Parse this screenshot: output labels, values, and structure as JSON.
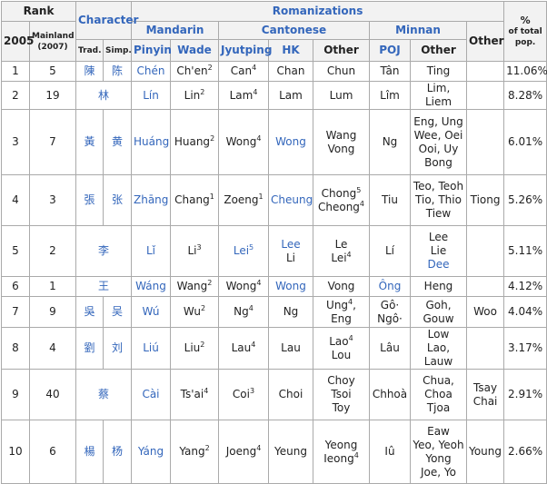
{
  "headers": {
    "rank": "Rank",
    "character": "Character",
    "romanizations": "Romanizations",
    "percent": "% of total pop.",
    "percent_top": "%",
    "percent_bottom": "of total pop.",
    "rank_2005": "2005",
    "rank_mainland": "Mainland (2007)",
    "trad": "Trad.",
    "simp": "Simp.",
    "mandarin": "Mandarin",
    "cantonese": "Cantonese",
    "minnan": "Minnan",
    "other_col": "Other",
    "pinyin": "Pinyin",
    "wade": "Wade",
    "jyutping": "Jyutping",
    "hk": "HK",
    "cant_other": "Other",
    "poj": "POJ",
    "minnan_other": "Other"
  },
  "rows": [
    {
      "r2005": "1",
      "mainland": "5",
      "trad": "陳",
      "simp": "陈",
      "pinyin": "Chén",
      "wade": "Ch'en",
      "wade_sup": "2",
      "jyutping": "Can",
      "jyut_sup": "4",
      "hk": "Chan",
      "cant_other": [
        "Chun"
      ],
      "poj": "Tân",
      "minnan_other": [
        "Ting"
      ],
      "other": "",
      "percent": "11.06%"
    },
    {
      "r2005": "2",
      "mainland": "19",
      "char": "林",
      "pinyin": "Lín",
      "wade": "Lin",
      "wade_sup": "2",
      "jyutping": "Lam",
      "jyut_sup": "4",
      "hk": "Lam",
      "cant_other": [
        "Lum"
      ],
      "poj": "Lîm",
      "minnan_other": [
        "Lim, Liem"
      ],
      "other": "",
      "percent": "8.28%"
    },
    {
      "r2005": "3",
      "mainland": "7",
      "trad": "黃",
      "simp": "黄",
      "pinyin": "Huáng",
      "wade": "Huang",
      "wade_sup": "2",
      "jyutping": "Wong",
      "jyut_sup": "4",
      "hk": "Wong",
      "cant_other": [
        "Wang",
        "Vong"
      ],
      "poj": "Ng",
      "minnan_other": [
        "Eng, Ung",
        "Wee, Oei",
        "Ooi, Uy",
        "Bong"
      ],
      "other": "",
      "percent": "6.01%"
    },
    {
      "r2005": "4",
      "mainland": "3",
      "trad": "張",
      "simp": "张",
      "pinyin": "Zhāng",
      "wade": "Chang",
      "wade_sup": "1",
      "jyutping": "Zoeng",
      "jyut_sup": "1",
      "hk": "Cheung",
      "cant_other": [
        "Chong",
        "Cheong"
      ],
      "cant_other_sups": [
        "5",
        "4"
      ],
      "poj": "Tiu",
      "minnan_other": [
        "Teo, Teoh",
        "Tio, Thio",
        "Tiew"
      ],
      "other": "Tiong",
      "percent": "5.26%"
    },
    {
      "r2005": "5",
      "mainland": "2",
      "char": "李",
      "pinyin": "Lǐ",
      "wade": "Li",
      "wade_sup": "3",
      "jyutping": "Lei",
      "jyut_sup": "5",
      "hk_lines": [
        "Lee",
        "Li"
      ],
      "cant_other": [
        "Le",
        "Lei"
      ],
      "cant_other_sups": [
        "",
        "4"
      ],
      "poj": "Lí",
      "minnan_other": [
        "Lee",
        "Lie",
        "Dee"
      ],
      "other": "",
      "percent": "5.11%"
    },
    {
      "r2005": "6",
      "mainland": "1",
      "char": "王",
      "pinyin": "Wáng",
      "wade": "Wang",
      "wade_sup": "2",
      "jyutping": "Wong",
      "jyut_sup": "4",
      "hk": "Wong",
      "cant_other": [
        "Vong"
      ],
      "poj": "Ông",
      "minnan_other": [
        "Heng"
      ],
      "other": "",
      "percent": "4.12%"
    },
    {
      "r2005": "7",
      "mainland": "9",
      "trad": "吳",
      "simp": "吴",
      "pinyin": "Wú",
      "wade": "Wu",
      "wade_sup": "2",
      "jyutping": "Ng",
      "jyut_sup": "4",
      "hk": "Ng",
      "cant_other_inline": "Ung",
      "cant_other_inline_sup": "4",
      "cant_other_inline_rest": ", Eng",
      "poj_lines": [
        "Gô·",
        "Ngô·"
      ],
      "minnan_other": [
        "Goh, Gouw"
      ],
      "other": "Woo",
      "percent": "4.04%"
    },
    {
      "r2005": "8",
      "mainland": "4",
      "trad": "劉",
      "simp": "刘",
      "pinyin": "Liú",
      "wade": "Liu",
      "wade_sup": "2",
      "jyutping": "Lau",
      "jyut_sup": "4",
      "hk": "Lau",
      "cant_other": [
        "Lao",
        "Lou"
      ],
      "cant_other_sups": [
        "4",
        ""
      ],
      "poj": "Lâu",
      "minnan_other": [
        "Low",
        "Lao, Lauw"
      ],
      "other": "",
      "percent": "3.17%"
    },
    {
      "r2005": "9",
      "mainland": "40",
      "char": "蔡",
      "pinyin": "Cài",
      "wade": "Ts'ai",
      "wade_sup": "4",
      "jyutping": "Coi",
      "jyut_sup": "3",
      "hk": "Choi",
      "cant_other": [
        "Choy",
        "Tsoi",
        "Toy"
      ],
      "poj": "Chhoà",
      "minnan_other": [
        "Chua, Choa",
        "Tjoa"
      ],
      "other_lines": [
        "Tsay",
        "Chai"
      ],
      "percent": "2.91%"
    },
    {
      "r2005": "10",
      "mainland": "6",
      "trad": "楊",
      "simp": "杨",
      "pinyin": "Yáng",
      "wade": "Yang",
      "wade_sup": "2",
      "jyutping": "Joeng",
      "jyut_sup": "4",
      "hk": "Yeung",
      "cant_other": [
        "Yeong",
        "Ieong"
      ],
      "cant_other_sups": [
        "",
        "4"
      ],
      "poj": "Iû",
      "minnan_other": [
        "Eaw",
        "Yeo, Yeoh",
        "Yong",
        "Joe, Yo"
      ],
      "other": "Young",
      "percent": "2.66%"
    }
  ],
  "colors": {
    "header_bg": "#f2f2f2",
    "link": "#3366bb",
    "border": "#aaaaaa"
  }
}
